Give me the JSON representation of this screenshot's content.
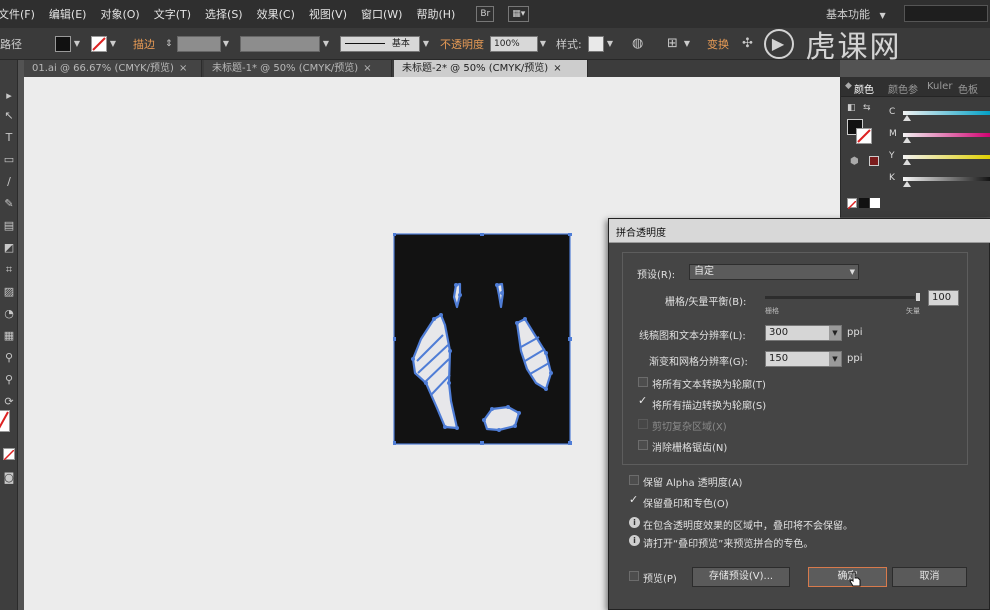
{
  "menubar": {
    "items": [
      "文件(F)",
      "编辑(E)",
      "对象(O)",
      "文字(T)",
      "选择(S)",
      "效果(C)",
      "视图(V)",
      "窗口(W)",
      "帮助(H)"
    ],
    "br_label": "Br",
    "workspace_label": "基本功能"
  },
  "controlbar": {
    "object_type": "路径",
    "stroke_label": "描边",
    "stroke_style": "基本",
    "opacity_label": "不透明度",
    "opacity_value": "100%",
    "style_label": "样式:",
    "transform_label": "变换"
  },
  "watermark": {
    "text": "虎课网"
  },
  "tabs": [
    {
      "label": "01.ai @ 66.67% (CMYK/预览)",
      "close": "×",
      "active": false
    },
    {
      "label": "未标题-1* @ 50% (CMYK/预览)",
      "close": "×",
      "active": false
    },
    {
      "label": "未标题-2* @ 50% (CMYK/预览)",
      "close": "×",
      "active": true
    }
  ],
  "tools": [
    "▸",
    "↖",
    "T",
    "▭",
    "∕",
    "✎",
    "▤",
    "◩",
    "⌗",
    "▨",
    "◔",
    "▦",
    "⚲",
    "⟳",
    "✥"
  ],
  "color_panel": {
    "tabs": [
      "颜色",
      "颜色参",
      "Kuler",
      "色板"
    ],
    "channels": [
      "C",
      "M",
      "Y",
      "K"
    ],
    "fill_color": "#111111",
    "stroke_color": "#d7d7d7",
    "selected_swatch": "#7a1c1c"
  },
  "dialog": {
    "title": "拼合透明度",
    "preset_label": "预设(R):",
    "preset_value": "自定",
    "balance_label": "栅格/矢量平衡(B):",
    "balance_min": "栅格",
    "balance_max": "矢量",
    "balance_value": "100",
    "raster_res_label": "线稿图和文本分辨率(L):",
    "raster_res_value": "300",
    "gradient_res_label": "渐变和网格分辨率(G):",
    "gradient_res_value": "150",
    "unit": "ppi",
    "options": [
      {
        "label": "将所有文本转换为轮廓(T)",
        "checked": false,
        "enabled": true
      },
      {
        "label": "将所有描边转换为轮廓(S)",
        "checked": true,
        "enabled": true
      },
      {
        "label": "剪切复杂区域(X)",
        "checked": false,
        "enabled": false
      },
      {
        "label": "消除栅格锯齿(N)",
        "checked": false,
        "enabled": true
      }
    ],
    "preserve_alpha": {
      "label": "保留 Alpha 透明度(A)",
      "checked": false
    },
    "preserve_overprint": {
      "label": "保留叠印和专色(O)",
      "checked": true
    },
    "info": [
      "在包含透明度效果的区域中，叠印将不会保留。",
      "请打开“叠印预览”来预览拼合的专色。"
    ],
    "preview": {
      "label": "预览(P)",
      "checked": false
    },
    "save_preset_label": "存储预设(V)...",
    "ok_label": "确定",
    "cancel_label": "取消"
  },
  "colors": {
    "accent_orange": "#d87a4c",
    "selection_blue": "#4f7dd6"
  }
}
